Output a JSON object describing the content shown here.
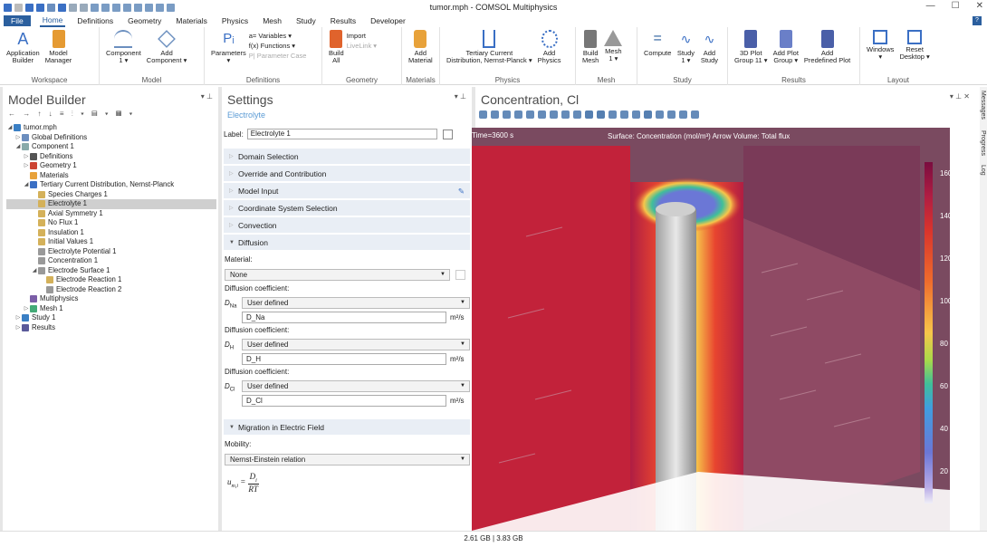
{
  "window": {
    "title": "tumor.mph - COMSOL Multiphysics",
    "min": "—",
    "max": "☐",
    "close": "✕"
  },
  "menu": {
    "file": "File",
    "home": "Home",
    "definitions": "Definitions",
    "geometry": "Geometry",
    "materials": "Materials",
    "physics": "Physics",
    "mesh": "Mesh",
    "study": "Study",
    "results": "Results",
    "developer": "Developer",
    "help": "?"
  },
  "ribbon": {
    "workspace": {
      "label": "Workspace",
      "app_builder": "Application\nBuilder",
      "model_manager": "Model\nManager"
    },
    "model": {
      "label": "Model",
      "component": "Component\n1 ▾",
      "add_component": "Add\nComponent ▾"
    },
    "definitions": {
      "label": "Definitions",
      "parameters": "Parameters\n▾",
      "variables": "a= Variables ▾",
      "functions": "f(x) Functions ▾",
      "param_case": "P| Parameter Case"
    },
    "geometry": {
      "label": "Geometry",
      "build_all": "Build\nAll",
      "import": "Import",
      "livelink": "LiveLink ▾"
    },
    "materials": {
      "label": "Materials",
      "add_material": "Add\nMaterial"
    },
    "physics": {
      "label": "Physics",
      "tertiary": "Tertiary Current\nDistribution, Nernst-Planck ▾",
      "add_physics": "Add\nPhysics"
    },
    "mesh": {
      "label": "Mesh",
      "build_mesh": "Build\nMesh",
      "mesh1": "Mesh\n1 ▾"
    },
    "study": {
      "label": "Study",
      "compute": "Compute",
      "study1": "Study\n1 ▾",
      "add_study": "Add\nStudy"
    },
    "results": {
      "label": "Results",
      "plot_group": "3D Plot\nGroup 11 ▾",
      "add_plot": "Add Plot\nGroup ▾",
      "add_predefined": "Add\nPredefined Plot"
    },
    "layout": {
      "label": "Layout",
      "windows": "Windows\n▾",
      "reset": "Reset\nDesktop ▾"
    }
  },
  "model_builder": {
    "title": "Model Builder",
    "nodes": [
      {
        "text": "tumor.mph",
        "indent": 0,
        "arrow": "◢",
        "icon": "#3a7fc4"
      },
      {
        "text": "Global Definitions",
        "indent": 1,
        "arrow": "▷",
        "icon": "#6c8ebf"
      },
      {
        "text": "Component 1",
        "indent": 1,
        "arrow": "◢",
        "icon": "#8aa"
      },
      {
        "text": "Definitions",
        "indent": 2,
        "arrow": "▷",
        "icon": "#555"
      },
      {
        "text": "Geometry 1",
        "indent": 2,
        "arrow": "▷",
        "icon": "#c43"
      },
      {
        "text": "Materials",
        "indent": 2,
        "arrow": "",
        "icon": "#e8a23a"
      },
      {
        "text": "Tertiary Current Distribution, Nernst-Planck",
        "indent": 2,
        "arrow": "◢",
        "icon": "#3a6fc4"
      },
      {
        "text": "Species Charges 1",
        "indent": 3,
        "arrow": "",
        "icon": "#d4b15a"
      },
      {
        "text": "Electrolyte 1",
        "indent": 3,
        "arrow": "",
        "icon": "#d4b15a",
        "selected": true
      },
      {
        "text": "Axial Symmetry 1",
        "indent": 3,
        "arrow": "",
        "icon": "#d4b15a"
      },
      {
        "text": "No Flux 1",
        "indent": 3,
        "arrow": "",
        "icon": "#d4b15a"
      },
      {
        "text": "Insulation 1",
        "indent": 3,
        "arrow": "",
        "icon": "#d4b15a"
      },
      {
        "text": "Initial Values 1",
        "indent": 3,
        "arrow": "",
        "icon": "#d4b15a"
      },
      {
        "text": "Electrolyte Potential 1",
        "indent": 3,
        "arrow": "",
        "icon": "#999"
      },
      {
        "text": "Concentration 1",
        "indent": 3,
        "arrow": "",
        "icon": "#999"
      },
      {
        "text": "Electrode Surface 1",
        "indent": 3,
        "arrow": "◢",
        "icon": "#999"
      },
      {
        "text": "Electrode Reaction 1",
        "indent": 4,
        "arrow": "",
        "icon": "#d4b15a"
      },
      {
        "text": "Electrode Reaction 2",
        "indent": 4,
        "arrow": "",
        "icon": "#999"
      },
      {
        "text": "Multiphysics",
        "indent": 2,
        "arrow": "",
        "icon": "#7b5ea7"
      },
      {
        "text": "Mesh 1",
        "indent": 2,
        "arrow": "▷",
        "icon": "#4a7"
      },
      {
        "text": "Study 1",
        "indent": 1,
        "arrow": "▷",
        "icon": "#3a7fc4"
      },
      {
        "text": "Results",
        "indent": 1,
        "arrow": "▷",
        "icon": "#5a5a9a"
      }
    ]
  },
  "settings": {
    "title": "Settings",
    "subtitle": "Electrolyte",
    "label_caption": "Label:",
    "label_value": "Electrolyte 1",
    "sections": [
      "Domain Selection",
      "Override and Contribution",
      "Model Input",
      "Coordinate System Selection",
      "Convection"
    ],
    "diffusion": "Diffusion",
    "material_caption": "Material:",
    "material_value": "None",
    "diff_caption": "Diffusion coefficient:",
    "rows": [
      {
        "sym": "DNa",
        "sub": "Na",
        "option": "User defined",
        "value": "D_Na",
        "unit": "m²/s"
      },
      {
        "sym": "DH",
        "sub": "H",
        "option": "User defined",
        "value": "D_H",
        "unit": "m²/s"
      },
      {
        "sym": "DCl",
        "sub": "Cl",
        "option": "User defined",
        "value": "D_Cl",
        "unit": "m²/s"
      }
    ],
    "migration": "Migration in Electric Field",
    "mobility_caption": "Mobility:",
    "mobility_value": "Nernst-Einstein relation",
    "formula": "u_m,i = D_i / RT"
  },
  "graphics": {
    "title": "Concentration, Cl",
    "time_label": "Time=3600 s",
    "plot_title": "Surface: Concentration (mol/m³)  Arrow Volume: Total flux",
    "ticks": [
      "160",
      "140",
      "120",
      "100",
      "80",
      "60",
      "40",
      "20"
    ]
  },
  "side_tabs": {
    "messages": "Messages",
    "progress": "Progress",
    "log": "Log"
  },
  "status": {
    "memory": "2.61 GB | 3.83 GB"
  }
}
